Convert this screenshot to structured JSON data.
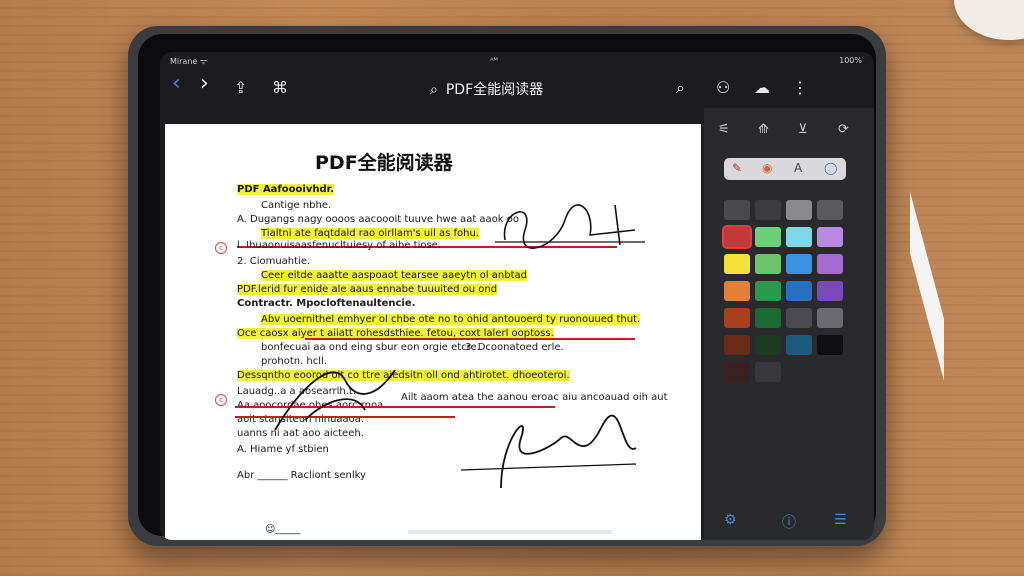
{
  "status": {
    "left": "Mirane ᯤ",
    "center": "ᴬᴹ",
    "right": "100%"
  },
  "toolbar": {
    "back": "‹",
    "forward": "›",
    "share": "⇪",
    "bookmark": "⌘",
    "search_glyph": "⌕",
    "title": "PDF全能阅读器",
    "search": "⌕",
    "people": "⚇",
    "comment": "☁",
    "more": "⋮"
  },
  "document": {
    "title": "PDF全能阅读器",
    "lines": [
      "PDF Aafoooivhdr.",
      "Cantige nbhe.",
      "A. Dugangs nagy oooos aacoooit tuuve hwe aat aaok oo",
      "Tialtni ate faqtdald rao oirllam's uil as fohu.",
      "l. Ihuaonuisaasfenucltuiesy of aihe tiose.",
      "2. Ciomuahtie.",
      "Ceer eitde aaatte aaspoaot tearsee aaeytn ol anbtad",
      "PDF.lerid fur enide ale aaus ennabe tuuuited ou ond",
      "Contractr. Mpocloftenaultencie.",
      "Abv uoernithel emhyer ol chbe ote no to ohid antouoerd ty ruonouued thut.",
      "Oce caosx aiyer t aiiatt rohesdsthiee. fetou, coxt lalerl ooptoss.",
      "bonfecuai aa ond eing sbur eon orgie etcre.",
      "3. Dcoonatoed erle.",
      "prohotn. hcll.",
      "Dessqntho eoorod olt co ttre aiedsitn oll ond ahtirotet. dhoeoteroi.",
      "Lauadg..a a aosearrlh.t.",
      "Aa aoocordae ohes aorc rnoa.",
      "aoit stansiteun ninuaaoa.",
      "uanns ni aat aoo aicteeh.",
      "Ailt aaom atea the aanou eroac aiu ancoauad oih aut",
      "A. Hiame yf stbien",
      "Abr ______ Racliont senlky",
      "☺_____"
    ]
  },
  "panel": {
    "tool_icons": [
      "⚟",
      "⟰",
      "⊻",
      "⟳"
    ],
    "segments": [
      "✎",
      "◉",
      "A",
      "◯"
    ],
    "swatch_rows": [
      [
        "#4a4a4e",
        "#3c3c40",
        "#8a8a8e",
        "#5a5a5e"
      ],
      [
        "#bf3a3a",
        "#6cd07c",
        "#7fd8e8",
        "#b98be0"
      ],
      [
        "#f2e23a",
        "#6cc46c",
        "#3a92e0",
        "#a46cd0"
      ],
      [
        "#e0803a",
        "#2a9a4a",
        "#2a70c0",
        "#7a4ab8"
      ],
      [
        "#a8401e",
        "#1e6a34",
        "#4a4a50",
        "#6a6a70"
      ],
      [
        "#6a2a1a",
        "#1e3a22",
        "#1a5a7a",
        "#101012"
      ],
      [
        "#3a2020",
        "#38383c"
      ]
    ],
    "bottom_icons": [
      "⚙",
      "ⓘ",
      "☰"
    ]
  },
  "colors": {
    "highlight": "#f2ef3e",
    "strike": "#c21e1e",
    "accent": "#4a86d8"
  }
}
